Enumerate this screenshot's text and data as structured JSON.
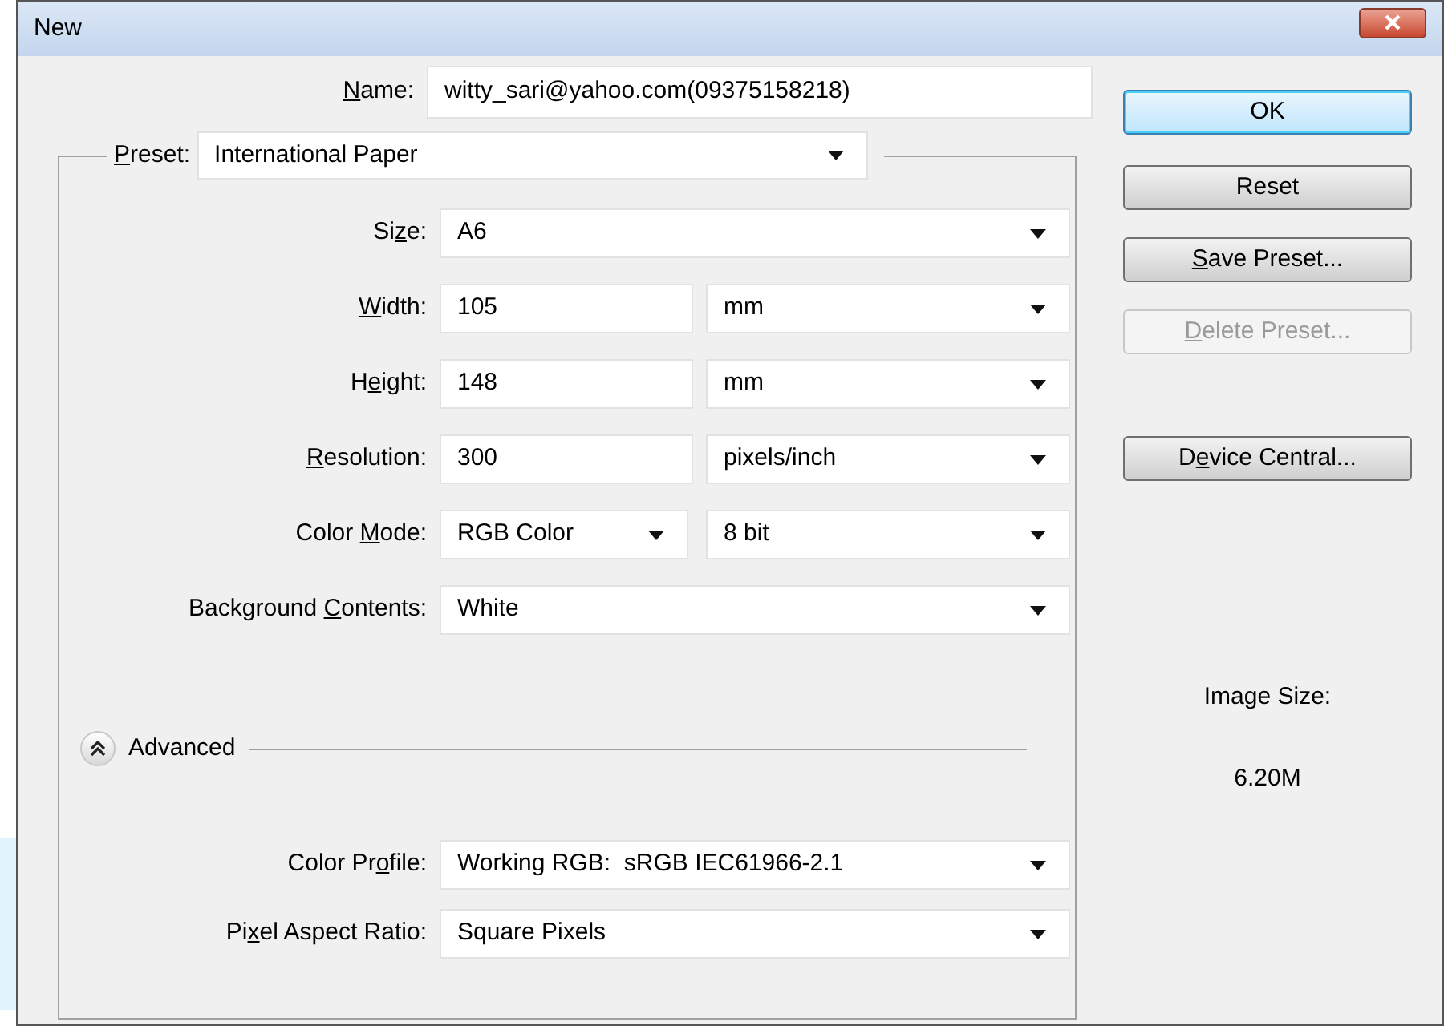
{
  "window": {
    "title": "New"
  },
  "name_field": {
    "label": {
      "key": "N",
      "post": "ame:"
    },
    "value": "witty_sari@yahoo.com(09375158218)"
  },
  "preset": {
    "label": {
      "key": "P",
      "post": "reset:"
    },
    "value": "International Paper"
  },
  "fields": [
    {
      "kind": "select",
      "label": {
        "pre": "Si",
        "key": "z",
        "post": "e:"
      },
      "value": "A6"
    },
    {
      "kind": "value_unit",
      "label": {
        "key": "W",
        "post": "idth:"
      },
      "value": "105",
      "unit": "mm"
    },
    {
      "kind": "value_unit",
      "label": {
        "pre": "H",
        "key": "e",
        "post": "ight:"
      },
      "value": "148",
      "unit": "mm"
    },
    {
      "kind": "value_unit",
      "label": {
        "key": "R",
        "post": "esolution:"
      },
      "value": "300",
      "unit": "pixels/inch"
    },
    {
      "kind": "select_pair",
      "label": {
        "pre": "Color ",
        "key": "M",
        "post": "ode:"
      },
      "value": "RGB Color",
      "unit": "8 bit"
    },
    {
      "kind": "select",
      "label": {
        "pre": "Background ",
        "key": "C",
        "post": "ontents:"
      },
      "value": "White"
    }
  ],
  "advanced": {
    "label": "Advanced",
    "expanded": true
  },
  "advanced_fields": [
    {
      "kind": "select",
      "label": {
        "pre": "Color Pr",
        "key": "o",
        "post": "file:"
      },
      "value": "Working RGB:  sRGB IEC61966-2.1"
    },
    {
      "kind": "select",
      "label": {
        "pre": "Pi",
        "key": "x",
        "post": "el Aspect Ratio:"
      },
      "value": "Square Pixels"
    }
  ],
  "buttons": [
    {
      "label": {
        "post": "OK"
      },
      "default": true,
      "disabled": false
    },
    {
      "label": {
        "post": "Reset"
      },
      "default": false,
      "disabled": false
    },
    {
      "label": {
        "key": "S",
        "post": "ave Preset..."
      },
      "default": false,
      "disabled": false
    },
    {
      "label": {
        "key": "D",
        "post": "elete Preset..."
      },
      "default": false,
      "disabled": true
    },
    {
      "label": {
        "pre": "D",
        "key": "e",
        "post": "vice Central..."
      },
      "default": false,
      "disabled": false
    }
  ],
  "image_size": {
    "label": "Image Size:",
    "value": "6.20M"
  }
}
